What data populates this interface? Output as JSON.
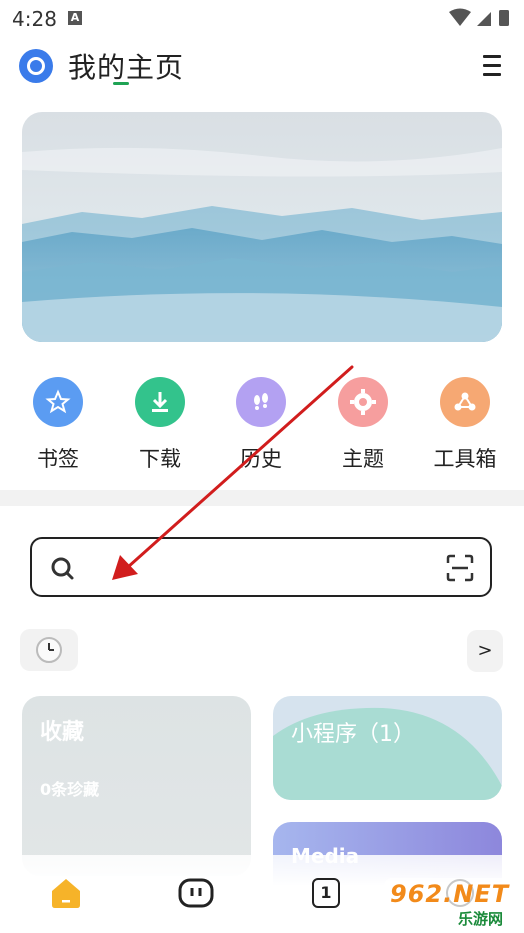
{
  "status_bar": {
    "time": "4:28",
    "notification_letter": "A"
  },
  "header": {
    "title": "我的主页"
  },
  "quick_actions": [
    {
      "label": "书签",
      "icon": "star-icon",
      "color": "#5b9cf2"
    },
    {
      "label": "下载",
      "icon": "download-icon",
      "color": "#33c38c"
    },
    {
      "label": "历史",
      "icon": "footprints-icon",
      "color": "#b3a1f2"
    },
    {
      "label": "主题",
      "icon": "gear-icon",
      "color": "#f69e9e"
    },
    {
      "label": "工具箱",
      "icon": "toolbox-icon",
      "color": "#f6a873"
    }
  ],
  "search": {
    "placeholder": ""
  },
  "history_row": {
    "more_label": ">"
  },
  "cards": {
    "favorites": {
      "title": "收藏",
      "count_text": "0条珍藏"
    },
    "mini_programs": {
      "title": "小程序（1）"
    },
    "media": {
      "title": "Media"
    }
  },
  "bottom_nav": {
    "tab_count": "1"
  },
  "watermark": {
    "brand": "962.NET",
    "sub": "乐游网"
  },
  "colors": {
    "accent": "#1fa354",
    "logo": "#3a7bea",
    "home_tab": "#f6b329"
  }
}
